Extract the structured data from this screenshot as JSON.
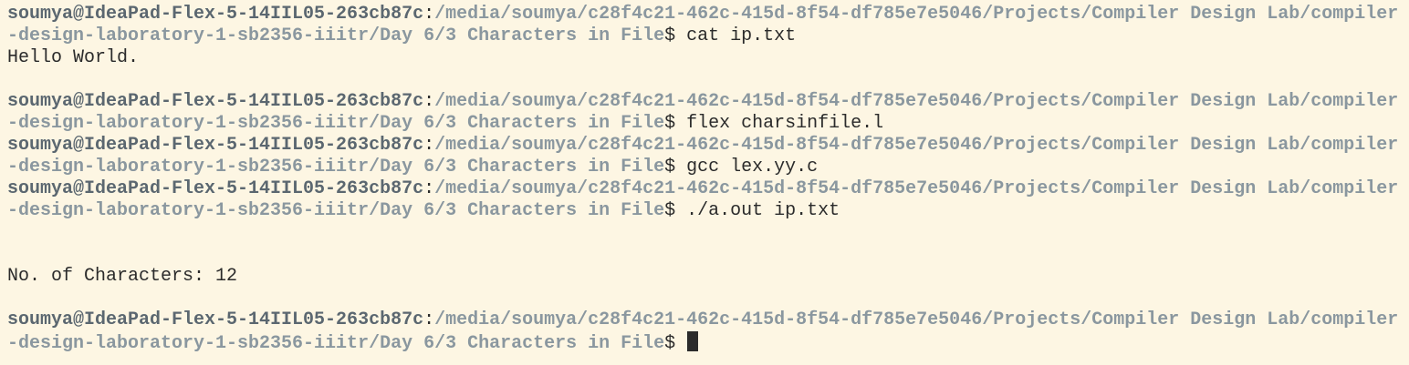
{
  "terminal": {
    "user_host": "soumya@IdeaPad-Flex-5-14IIL05-263cb87c",
    "colon": ":",
    "path_part1": "/media/soumya/c28f4c21-462c-415d-8f54-df785e7e5046/Projects/Compiler Design Lab/compiler",
    "path_part2": "-design-laboratory-1-sb2356-iiitr/Day 6/3 Characters in File",
    "prompt_symbol": "$",
    "commands": [
      " cat ip.txt",
      " flex charsinfile.l",
      " gcc lex.yy.c",
      " ./a.out ip.txt"
    ],
    "outputs": {
      "cat_output": "Hello World.",
      "program_output": "No. of Characters: 12"
    },
    "colors": {
      "background": "#fdf6e3",
      "user_host": "#5b6770",
      "path": "#8a979f",
      "text": "#2b2b2b"
    }
  }
}
